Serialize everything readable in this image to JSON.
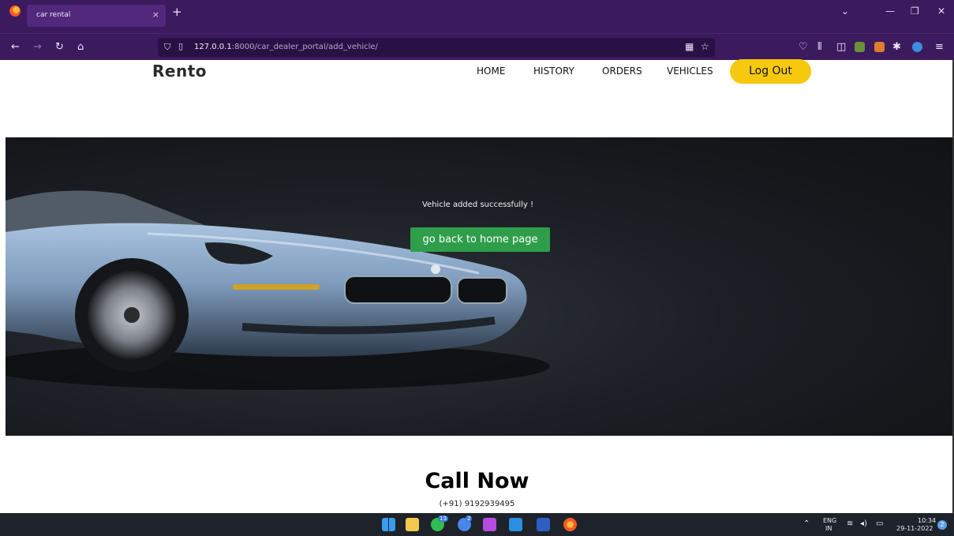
{
  "browser": {
    "tab_title": "car rental",
    "tab_close": "×",
    "new_tab": "+",
    "url_host": "127.0.0.1",
    "url_path": ":8000/car_dealer_portal/add_vehicle/"
  },
  "site": {
    "brand": "Rento",
    "nav": [
      "HOME",
      "HISTORY",
      "ORDERS",
      "VEHICLES"
    ],
    "logout_label": "Log Out"
  },
  "hero": {
    "message": "Vehicle added successfully !",
    "button_label": "go back to home page"
  },
  "contact": {
    "title": "Call Now",
    "phone": "(+91) 9192939495"
  },
  "taskbar": {
    "lang_top": "ENG",
    "lang_bottom": "IN",
    "time": "10:34",
    "date": "29-11-2022",
    "notifications": "2",
    "whatsapp_badge": "13",
    "todo_badge": "2"
  },
  "colors": {
    "accent_yellow": "#f6c90e",
    "button_green": "#2e9e4b",
    "browser_purple": "#3b1a5e"
  }
}
